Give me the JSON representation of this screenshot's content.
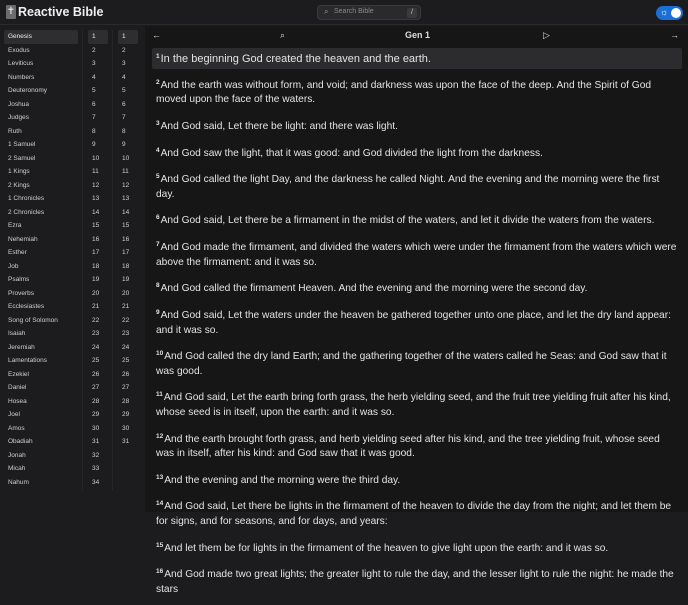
{
  "header": {
    "title": "Reactive Bible",
    "logo_glyph": "✝",
    "search_placeholder": "Search Bible",
    "search_shortcut": "/",
    "theme_icon": "sun-icon"
  },
  "books": [
    "Genesis",
    "Exodus",
    "Leviticus",
    "Numbers",
    "Deuteronomy",
    "Joshua",
    "Judges",
    "Ruth",
    "1 Samuel",
    "2 Samuel",
    "1 Kings",
    "2 Kings",
    "1 Chronicles",
    "2 Chronicles",
    "Ezra",
    "Nehemiah",
    "Esther",
    "Job",
    "Psalms",
    "Proverbs",
    "Ecclesiastes",
    "Song of Solomon",
    "Isaiah",
    "Jeremiah",
    "Lamentations",
    "Ezekiel",
    "Daniel",
    "Hosea",
    "Joel",
    "Amos",
    "Obadiah",
    "Jonah",
    "Micah",
    "Nahum"
  ],
  "selected_book": "Genesis",
  "chapters": [
    "1",
    "2",
    "3",
    "4",
    "5",
    "6",
    "7",
    "8",
    "9",
    "10",
    "11",
    "12",
    "13",
    "14",
    "15",
    "16",
    "17",
    "18",
    "19",
    "20",
    "21",
    "22",
    "23",
    "24",
    "25",
    "26",
    "27",
    "28",
    "29",
    "30",
    "31",
    "32",
    "33",
    "34"
  ],
  "verse_numbers": [
    "1",
    "2",
    "3",
    "4",
    "5",
    "6",
    "7",
    "8",
    "9",
    "10",
    "11",
    "12",
    "13",
    "14",
    "15",
    "16",
    "17",
    "18",
    "19",
    "20",
    "21",
    "22",
    "23",
    "24",
    "25",
    "26",
    "27",
    "28",
    "29",
    "30",
    "31"
  ],
  "nav": {
    "back": "←",
    "search": "⌕",
    "reference": "Gen 1",
    "play": "▷",
    "forward": "→"
  },
  "verses": [
    {
      "n": "1",
      "text": "In the beginning God created the heaven and the earth."
    },
    {
      "n": "2",
      "text": "And the earth was without form, and void; and darkness was upon the face of the deep. And the Spirit of God moved upon the face of the waters."
    },
    {
      "n": "3",
      "text": "And God said, Let there be light: and there was light."
    },
    {
      "n": "4",
      "text": "And God saw the light, that it was good: and God divided the light from the darkness."
    },
    {
      "n": "5",
      "text": "And God called the light Day, and the darkness he called Night. And the evening and the morning were the first day."
    },
    {
      "n": "6",
      "text": "And God said, Let there be a firmament in the midst of the waters, and let it divide the waters from the waters."
    },
    {
      "n": "7",
      "text": "And God made the firmament, and divided the waters which were under the firmament from the waters which were above the firmament: and it was so."
    },
    {
      "n": "8",
      "text": "And God called the firmament Heaven. And the evening and the morning were the second day."
    },
    {
      "n": "9",
      "text": "And God said, Let the waters under the heaven be gathered together unto one place, and let the dry land appear: and it was so."
    },
    {
      "n": "10",
      "text": "And God called the dry land Earth; and the gathering together of the waters called he Seas: and God saw that it was good."
    },
    {
      "n": "11",
      "text": "And God said, Let the earth bring forth grass, the herb yielding seed, and the fruit tree yielding fruit after his kind, whose seed is in itself, upon the earth: and it was so."
    },
    {
      "n": "12",
      "text": "And the earth brought forth grass, and herb yielding seed after his kind, and the tree yielding fruit, whose seed was in itself, after his kind: and God saw that it was good."
    },
    {
      "n": "13",
      "text": "And the evening and the morning were the third day."
    },
    {
      "n": "14",
      "text": "And God said, Let there be lights in the firmament of the heaven to divide the day from the night; and let them be for signs, and for seasons, and for days, and years:"
    },
    {
      "n": "15",
      "text": "And let them be for lights in the firmament of the heaven to give light upon the earth: and it was so."
    },
    {
      "n": "16",
      "text": "And God made two great lights; the greater light to rule the day, and the lesser light to rule the night: he made the stars"
    }
  ],
  "colors": {
    "accent": "#1a6fd6",
    "highlight": "#2c2c2e"
  }
}
